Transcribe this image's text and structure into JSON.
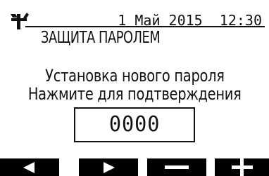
{
  "header": {
    "icon": "wrench-screwdriver-icon",
    "datetime": "1 Май 2015  12:30",
    "title": "ЗАЩИТА ПАРОЛЕМ"
  },
  "main": {
    "line1": "Установка нового пароля",
    "line2": "Нажмите для подтверждения",
    "pin": "0000"
  },
  "softkeys": [
    {
      "icon": "left-arrow-icon"
    },
    {
      "icon": "right-arrow-icon"
    },
    {
      "icon": "minus-icon"
    },
    {
      "icon": "plus-icon"
    }
  ],
  "colors": {
    "background": "#ffffff",
    "foreground": "#111111",
    "softkey_bg": "#000000",
    "softkey_fg": "#ffffff"
  }
}
